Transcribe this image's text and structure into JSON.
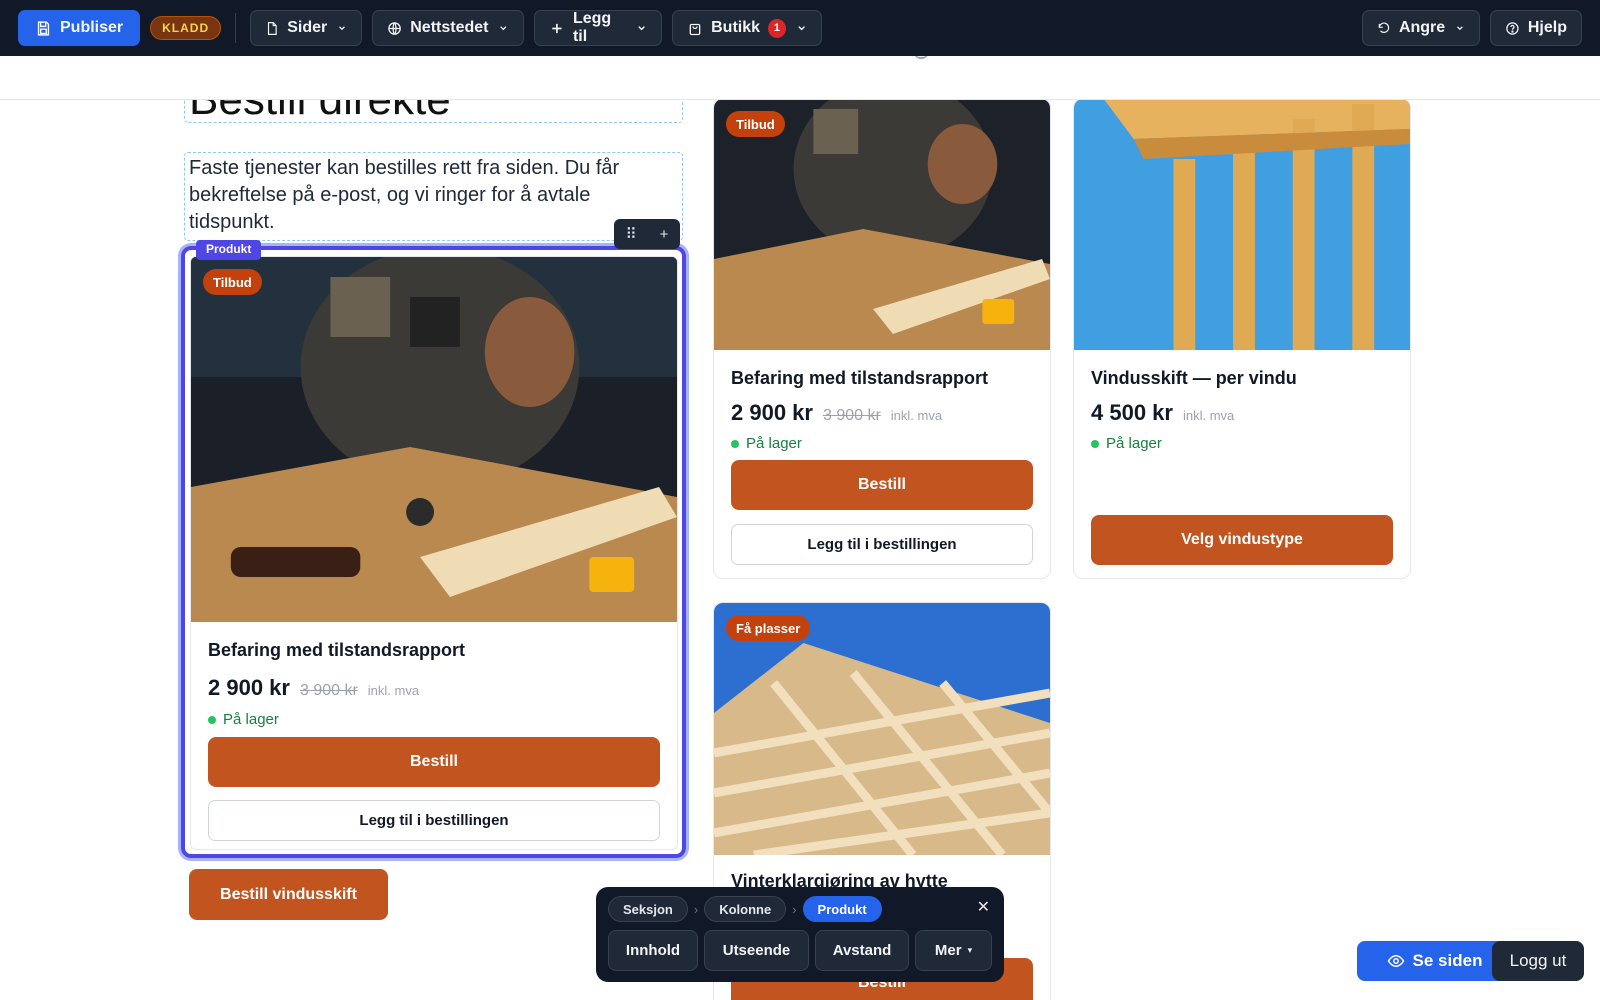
{
  "toolbar": {
    "publish": "Publiser",
    "draft_badge": "KLADD",
    "pages": "Sider",
    "website": "Nettstedet",
    "add": "Legg til",
    "shop": "Butikk",
    "shop_count": "1",
    "undo": "Angre",
    "help": "Hjelp"
  },
  "section": {
    "heading": "Bestill direkte",
    "paragraph": "Faste tjenester kan bestilles rett fra siden. Du får bekreftelse på e-post, og vi ringer for å avtale tidspunkt.",
    "selected_tag": "Produkt",
    "cta": "Bestill vindusskift"
  },
  "products": [
    {
      "badge": "Tilbud",
      "title": "Befaring med tilstandsrapport",
      "price": "2 900 kr",
      "old_price": "3 900 kr",
      "vat": "inkl. mva",
      "stock": "På lager",
      "primary": "Bestill",
      "secondary": "Legg til i bestillingen"
    },
    {
      "badge": "Tilbud",
      "title": "Befaring med tilstandsrapport",
      "price": "2 900 kr",
      "old_price": "3 900 kr",
      "vat": "inkl. mva",
      "stock": "På lager",
      "primary": "Bestill",
      "secondary": "Legg til i bestillingen"
    },
    {
      "title": "Vindusskift — per vindu",
      "price": "4 500 kr",
      "vat": "inkl. mva",
      "stock": "På lager",
      "primary": "Velg vindustype"
    },
    {
      "badge": "Få plasser",
      "title": "Vinterklargjøring av hytte",
      "primary": "Bestill"
    }
  ],
  "editor": {
    "crumbs": [
      "Seksjon",
      "Kolonne",
      "Produkt"
    ],
    "buttons": [
      "Innhold",
      "Utseende",
      "Avstand",
      "Mer"
    ]
  },
  "bottom": {
    "see_site": "Se siden",
    "logout": "Logg ut"
  },
  "colors": {
    "accent": "#c2541f",
    "selection": "#4f46e5",
    "toolbar": "#111827",
    "primary_blue": "#2563eb",
    "in_stock": "#22c55e"
  }
}
